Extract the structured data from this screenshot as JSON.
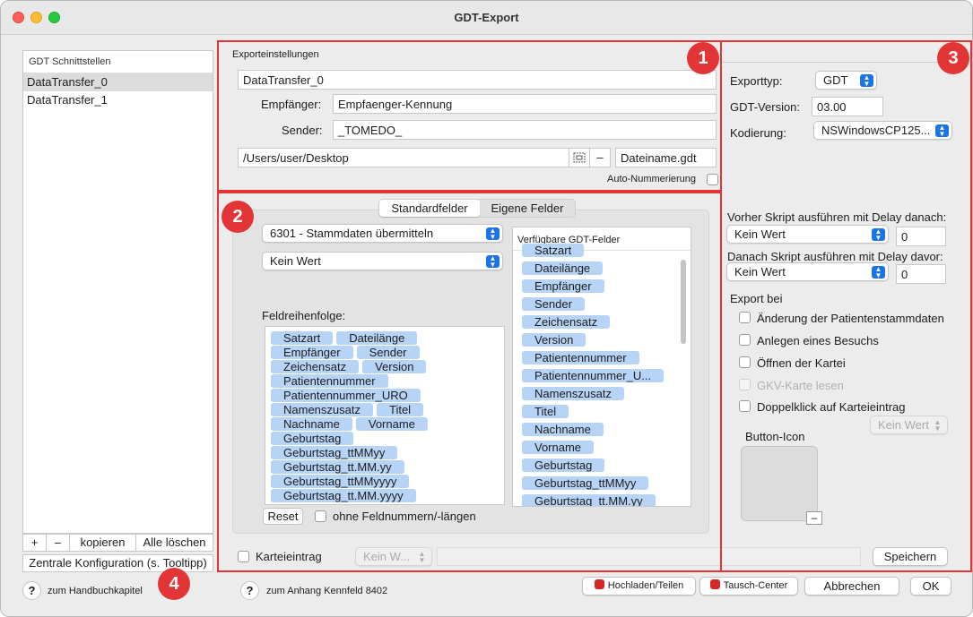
{
  "window": {
    "title": "GDT-Export"
  },
  "sidebar": {
    "header": "GDT Schnittstellen",
    "items": [
      "DataTransfer_0",
      "DataTransfer_1"
    ],
    "add_label": "+",
    "remove_label": "–",
    "copy_label": "kopieren",
    "delete_all_label": "Alle löschen",
    "central_config_label": "Zentrale Konfiguration (s. Tooltipp)"
  },
  "export_settings": {
    "title": "Exporteinstellungen",
    "name_value": "DataTransfer_0",
    "recipient_label": "Empfänger:",
    "recipient_value": "Empfaenger-Kennung",
    "sender_label": "Sender:",
    "sender_value": "_TOMEDO_",
    "path_value": "/Users/user/Desktop",
    "path_minus_label": "–",
    "filename_value": "Dateiname.gdt",
    "auto_numbering_label": "Auto-Nummerierung"
  },
  "fields": {
    "tab_standard": "Standardfelder",
    "tab_custom": "Eigene Felder",
    "record_type_value": "6301 - Stammdaten übermitteln",
    "second_popup_value": "Kein Wert",
    "order_label": "Feldreihenfolge:",
    "order_rows": [
      [
        "Satzart",
        "Dateilänge"
      ],
      [
        "Empfänger",
        "Sender"
      ],
      [
        "Zeichensatz",
        "Version"
      ],
      [
        "Patientennummer"
      ],
      [
        "Patientennummer_URO"
      ],
      [
        "Namenszusatz",
        "Titel"
      ],
      [
        "Nachname",
        "Vorname"
      ],
      [
        "Geburtstag"
      ],
      [
        "Geburtstag_ttMMyy"
      ],
      [
        "Geburtstag_tt.MM.yy"
      ],
      [
        "Geburtstag_ttMMyyyy"
      ],
      [
        "Geburtstag_tt.MM.yyyy"
      ]
    ],
    "reset_label": "Reset",
    "no_numbers_label": "ohne Feldnummern/-längen",
    "available_header": "Verfügbare GDT-Felder",
    "available_partial": "Satzart",
    "available_items": [
      "Dateilänge",
      "Empfänger",
      "Sender",
      "Zeichensatz",
      "Version",
      "Patientennummer",
      "Patientennummer_U...",
      "Namenszusatz",
      "Titel",
      "Nachname",
      "Vorname",
      "Geburtstag",
      "Geburtstag_ttMMyy",
      "Geburtstag_tt.MM.yy"
    ]
  },
  "karteieintrag": {
    "label": "Karteieintrag",
    "popup_value": "Kein W..."
  },
  "right_panel": {
    "export_type_label": "Exporttyp:",
    "export_type_value": "GDT",
    "gdt_version_label": "GDT-Version:",
    "gdt_version_value": "03.00",
    "encoding_label": "Kodierung:",
    "encoding_value": "NSWindowsCP125...",
    "pre_script_label": "Vorher Skript ausführen mit Delay danach:",
    "pre_script_value": "Kein Wert",
    "pre_delay_value": "0",
    "post_script_label": "Danach Skript ausführen mit Delay davor:",
    "post_script_value": "Kein Wert",
    "post_delay_value": "0",
    "export_on_label": "Export bei",
    "export_on_options": [
      "Änderung der Patientenstammdaten",
      "Anlegen eines Besuchs",
      "Öffnen der Kartei",
      "GKV-Karte lesen",
      "Doppelklick auf Karteieintrag"
    ],
    "double_click_value": "Kein Wert",
    "button_icon_label": "Button-Icon",
    "icon_minus_label": "–",
    "save_label": "Speichern"
  },
  "footer": {
    "manual_link": "zum Handbuchkapitel",
    "appendix_link": "zum Anhang Kennfeld 8402",
    "upload_label": "Hochladen/Teilen",
    "exchange_label": "Tausch-Center",
    "cancel_label": "Abbrechen",
    "ok_label": "OK"
  },
  "badges": [
    "1",
    "2",
    "3",
    "4"
  ],
  "colors": {
    "annotation_red": "#e23636",
    "accent_blue": "#1a73e8",
    "chip_blue": "#b7d3f6"
  }
}
